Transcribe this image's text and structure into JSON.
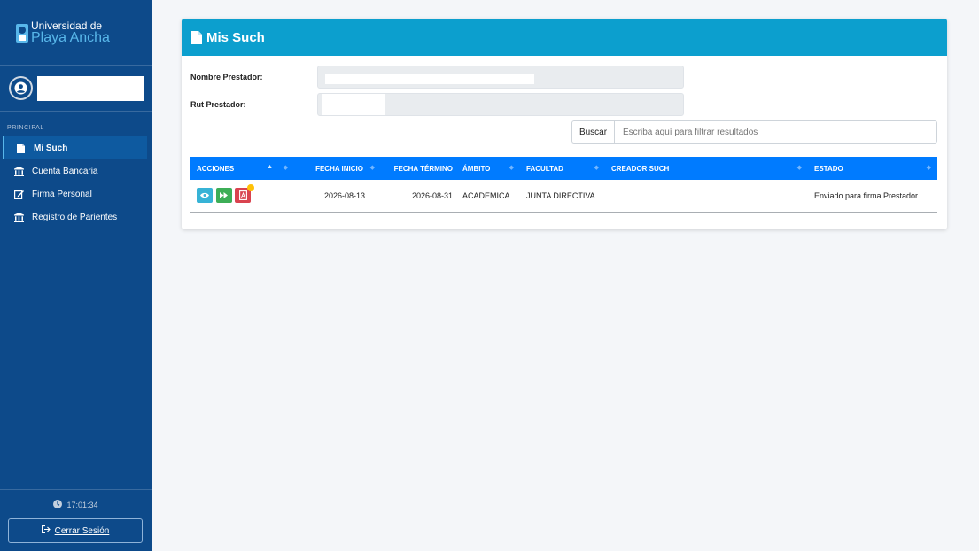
{
  "brand": {
    "line1": "Universidad de",
    "line2": "Playa Ancha"
  },
  "sidebar": {
    "section_header": "PRINCIPAL",
    "items": [
      {
        "label": "Mi Such",
        "icon": "file-icon",
        "active": true
      },
      {
        "label": "Cuenta Bancaria",
        "icon": "bank-icon",
        "active": false
      },
      {
        "label": "Firma Personal",
        "icon": "edit-icon",
        "active": false
      },
      {
        "label": "Registro de Parientes",
        "icon": "bank-icon",
        "active": false
      }
    ],
    "clock": "17:01:34",
    "logout_label": "Cerrar Sesión"
  },
  "card": {
    "title": "Mis Such",
    "fields": {
      "nombre_label": "Nombre Prestador:",
      "rut_label": "Rut Prestador:"
    },
    "search": {
      "button_label": "Buscar",
      "placeholder": "Escriba aquí para filtrar resultados"
    },
    "table": {
      "headers": [
        "ACCIONES",
        "FECHA INICIO",
        "FECHA TÉRMINO",
        "ÁMBITO",
        "FACULTAD",
        "CREADOR SUCH",
        "ESTADO"
      ],
      "rows": [
        {
          "fecha_inicio": "2026-08-13",
          "fecha_termino": "2026-08-31",
          "ambito": "ACADEMICA",
          "facultad": "JUNTA DIRECTIVA",
          "creador": "",
          "estado": "Enviado para firma Prestador"
        }
      ]
    }
  },
  "colors": {
    "sidebar_bg": "#0d4a8a",
    "card_header": "#0c9fce",
    "table_header": "#007bff",
    "btn_info": "#37b3d6",
    "btn_success": "#3dae57",
    "btn_danger": "#d9434f"
  }
}
